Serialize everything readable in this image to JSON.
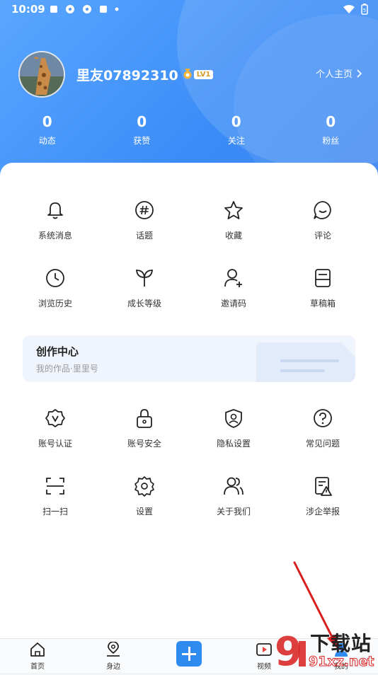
{
  "status_bar": {
    "time": "10:09",
    "battery": "5"
  },
  "profile": {
    "username": "里友07892310",
    "level": "LV1",
    "homepage_link": "个人主页"
  },
  "stats": [
    {
      "value": "0",
      "label": "动态"
    },
    {
      "value": "0",
      "label": "获赞"
    },
    {
      "value": "0",
      "label": "关注"
    },
    {
      "value": "0",
      "label": "粉丝"
    }
  ],
  "menu_row1": [
    {
      "label": "系统消息",
      "icon": "bell-icon"
    },
    {
      "label": "话题",
      "icon": "hashtag-icon"
    },
    {
      "label": "收藏",
      "icon": "star-icon"
    },
    {
      "label": "评论",
      "icon": "comment-icon"
    }
  ],
  "menu_row2": [
    {
      "label": "浏览历史",
      "icon": "clock-icon"
    },
    {
      "label": "成长等级",
      "icon": "leaf-icon"
    },
    {
      "label": "邀请码",
      "icon": "add-user-icon"
    },
    {
      "label": "草稿箱",
      "icon": "drafts-icon"
    }
  ],
  "creator_center": {
    "title": "创作中心",
    "subtitle": "我的作品·里里号"
  },
  "menu_row3": [
    {
      "label": "账号认证",
      "icon": "verify-badge-icon"
    },
    {
      "label": "账号安全",
      "icon": "lock-icon"
    },
    {
      "label": "隐私设置",
      "icon": "shield-user-icon"
    },
    {
      "label": "常见问题",
      "icon": "question-icon"
    }
  ],
  "menu_row4": [
    {
      "label": "扫一扫",
      "icon": "scan-icon"
    },
    {
      "label": "设置",
      "icon": "gear-icon"
    },
    {
      "label": "关于我们",
      "icon": "group-icon"
    },
    {
      "label": "涉企举报",
      "icon": "report-icon"
    }
  ],
  "tabbar": [
    {
      "label": "首页",
      "icon": "home-icon"
    },
    {
      "label": "身边",
      "icon": "location-icon"
    },
    {
      "label": "",
      "icon": "plus-icon"
    },
    {
      "label": "视频",
      "icon": "video-icon"
    },
    {
      "label": "我的",
      "icon": "profile-icon"
    }
  ],
  "watermark": {
    "brand": "下载站",
    "domain": "91xz.net"
  },
  "colors": {
    "primary": "#3b8cf7",
    "accent_annotation": "#d81e1e",
    "card_bg": "#f0f5fd"
  }
}
